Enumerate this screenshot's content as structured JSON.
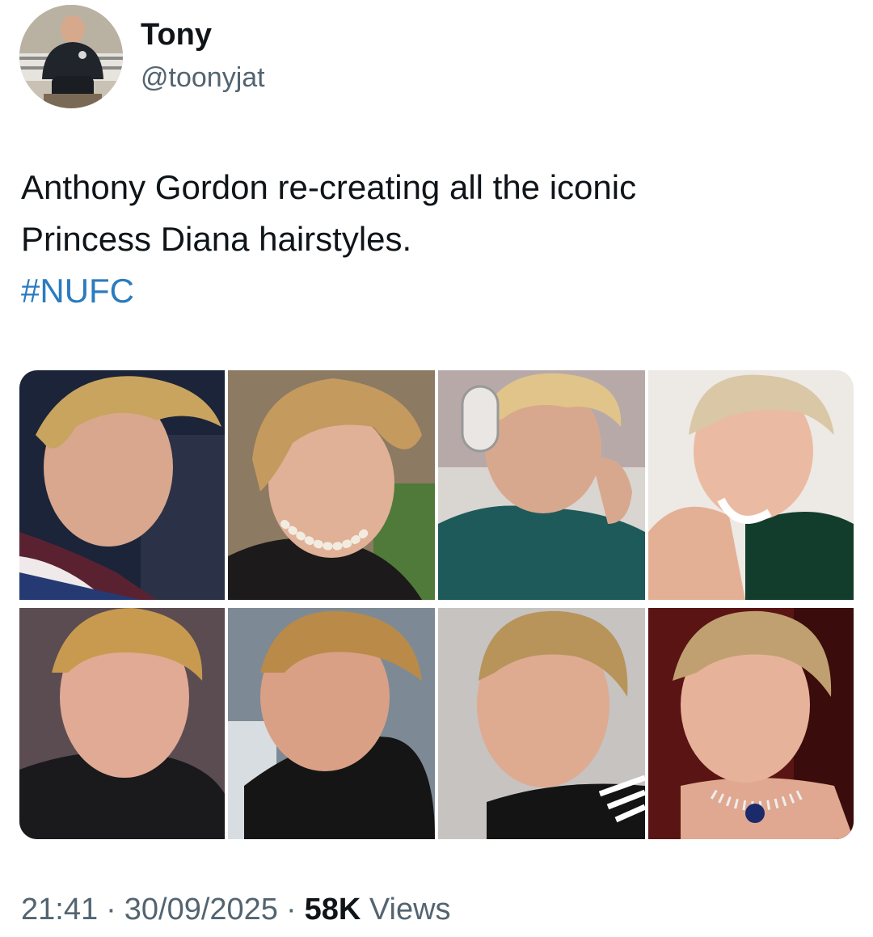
{
  "author": {
    "display_name": "Tony",
    "handle": "@toonyjat"
  },
  "tweet": {
    "text_line_1": "Anthony Gordon re-creating all the iconic",
    "text_line_2": "Princess Diana hairstyles.",
    "hashtag": "#NUFC"
  },
  "media": {
    "photos": [
      {
        "icon": "photo-gordon-1"
      },
      {
        "icon": "photo-diana-1"
      },
      {
        "icon": "photo-gordon-2"
      },
      {
        "icon": "photo-diana-2"
      },
      {
        "icon": "photo-gordon-3"
      },
      {
        "icon": "photo-diana-3"
      },
      {
        "icon": "photo-gordon-4"
      },
      {
        "icon": "photo-diana-4"
      }
    ]
  },
  "meta": {
    "time": "21:41",
    "separator": "·",
    "date": "30/09/2025",
    "views_count": "58K",
    "views_label": "Views"
  },
  "colors": {
    "text": "#0f1419",
    "secondary": "#536471",
    "hashtag": "#2b7bbf",
    "background": "#ffffff"
  }
}
